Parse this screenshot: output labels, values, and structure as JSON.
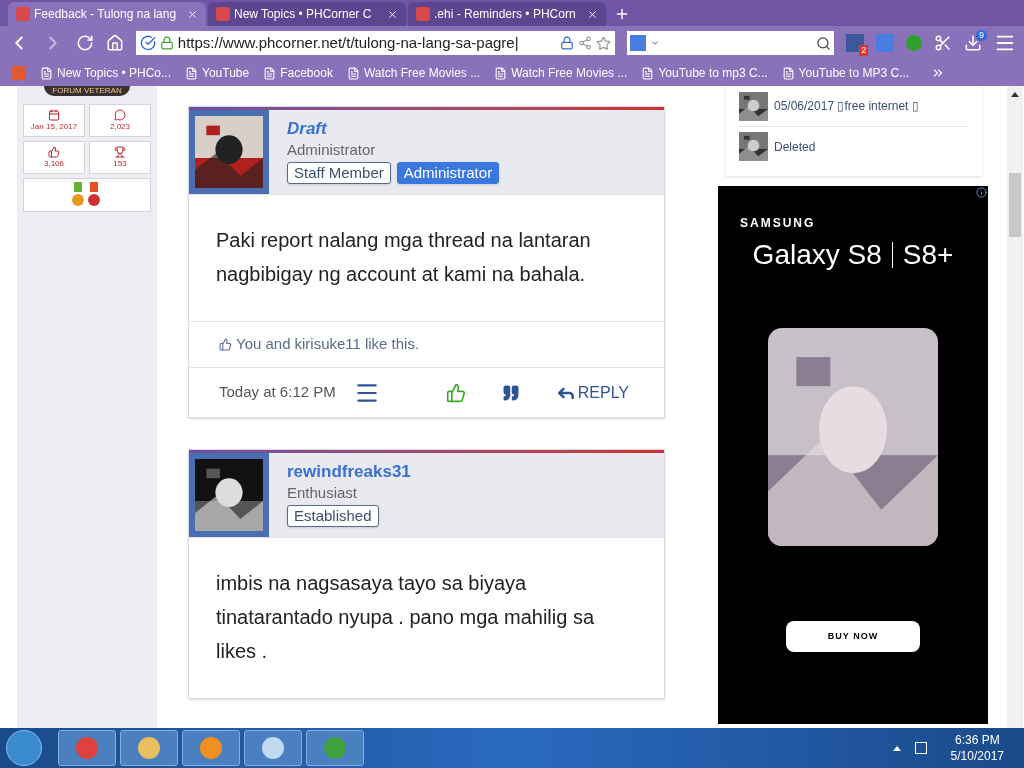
{
  "browser": {
    "tabs": [
      {
        "title": "Feedback - Tulong na lang",
        "selected": true
      },
      {
        "title": "New Topics • PHCorner C",
        "selected": false
      },
      {
        "title": ".ehi - Reminders • PHCorn",
        "selected": false
      }
    ],
    "url": "https://www.phcorner.net/t/tulong-na-lang-sa-pagre|",
    "search_badge": "2",
    "download_badge": "9",
    "bookmarks": [
      "New Topics • PHCo...",
      "YouTube",
      "Facebook",
      "Watch Free Movies ...",
      "Watch Free Movies ...",
      "YouTube to mp3 C...",
      "YouTube to MP3 C..."
    ]
  },
  "left": {
    "rank": "FORUM VETERAN",
    "stats": [
      {
        "kind": "calendar",
        "value": "Jan 15, 2017"
      },
      {
        "kind": "message",
        "value": "2,023"
      },
      {
        "kind": "like",
        "value": "3,106"
      },
      {
        "kind": "trophy",
        "value": "153"
      }
    ]
  },
  "posts": [
    {
      "author": "Draft",
      "author_italic": true,
      "title": "Administrator",
      "badges": [
        {
          "label": "Staff Member",
          "selected": false
        },
        {
          "label": "Administrator",
          "selected": true
        }
      ],
      "body": [
        "Paki report nalang mga thread na lantaran",
        "nagbibigay ng account at kami na bahala."
      ],
      "likes": {
        "you": "You and",
        "user": "kirisuke11",
        "rest": "like this."
      },
      "time": "Today at 6:12 PM",
      "reply": "REPLY"
    },
    {
      "author": "rewindfreaks31",
      "author_italic": false,
      "title": "Enthusiast",
      "badges": [
        {
          "label": "Established",
          "selected": false
        }
      ],
      "body": [
        "imbis na nagsasaya tayo sa biyaya",
        "tinatarantado nyupa . pano mga mahilig sa",
        "likes ."
      ]
    }
  ],
  "sidebar": {
    "items": [
      "05/06/2017 ▯free internet ▯",
      "Deleted"
    ]
  },
  "ad": {
    "brand": "SAMSUNG",
    "model": "Galaxy S8",
    "model2": "S8+",
    "cta": "BUY NOW"
  },
  "taskbar": {
    "time": "6:36 PM",
    "date": "5/10/2017"
  }
}
